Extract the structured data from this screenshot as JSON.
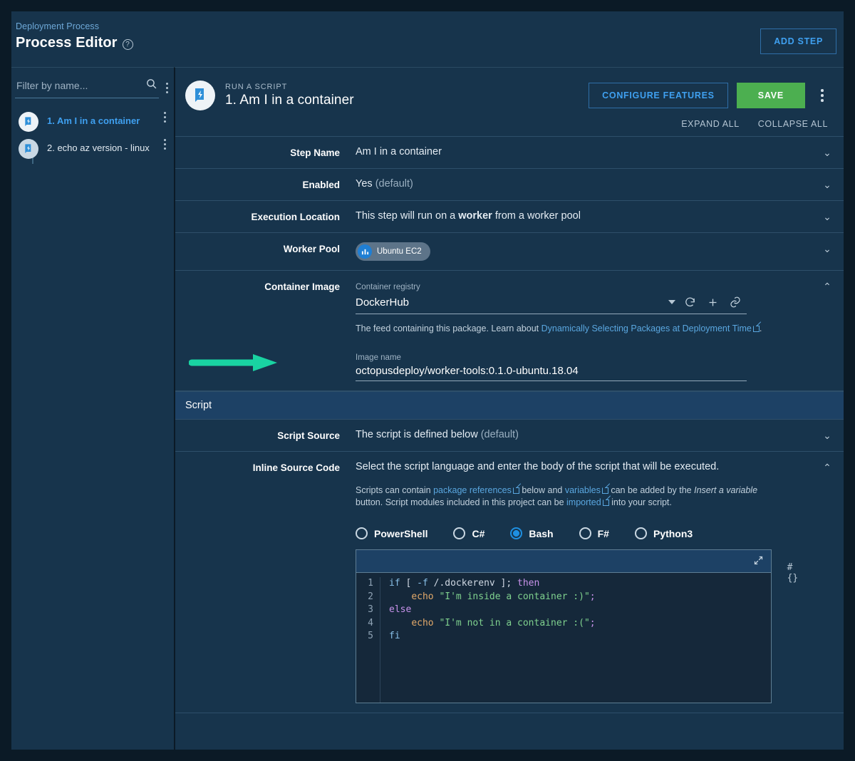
{
  "header": {
    "breadcrumb": "Deployment Process",
    "title": "Process Editor",
    "help_icon": "?",
    "add_step_label": "ADD STEP"
  },
  "sidebar": {
    "filter_placeholder": "Filter by name...",
    "filter_value": "",
    "search_icon": "search-icon",
    "steps": [
      {
        "label": "1. Am I in a container",
        "active": true
      },
      {
        "label": "2. echo az version - linux",
        "active": false
      }
    ]
  },
  "step": {
    "kicker": "RUN A SCRIPT",
    "title": "1. Am I in a container",
    "configure_features_label": "CONFIGURE FEATURES",
    "save_label": "SAVE",
    "expand_all": "EXPAND ALL",
    "collapse_all": "COLLAPSE ALL"
  },
  "rows": {
    "step_name": {
      "label": "Step Name",
      "value": "Am I in a container",
      "chevron": "⌄"
    },
    "enabled": {
      "label": "Enabled",
      "value": "Yes",
      "suffix": "(default)",
      "chevron": "⌄"
    },
    "execution_location": {
      "label": "Execution Location",
      "pre": "This step will run on a ",
      "strong": "worker",
      "post": " from a worker pool",
      "chevron": "⌄"
    },
    "worker_pool": {
      "label": "Worker Pool",
      "chip": "Ubuntu EC2",
      "chevron": "⌄"
    },
    "container_image": {
      "label": "Container Image",
      "chevron": "⌃"
    },
    "script_source": {
      "label": "Script Source",
      "value": "The script is defined below",
      "suffix": "(default)",
      "chevron": "⌄"
    },
    "inline_source_code": {
      "label": "Inline Source Code",
      "value": "Select the script language and enter the body of the script that will be executed.",
      "chevron": "⌃"
    }
  },
  "container_image": {
    "registry_label": "Container registry",
    "registry_value": "DockerHub",
    "refresh_icon": "refresh-icon",
    "add_icon": "plus-icon",
    "link_icon": "link-icon",
    "feed_help_pre": "The feed containing this package. Learn about ",
    "feed_help_link": "Dynamically Selecting Packages at Deployment Time",
    "feed_help_post": ".",
    "image_name_label": "Image name",
    "image_name_value": "octopusdeploy/worker-tools:0.1.0-ubuntu.18.04"
  },
  "script_section": {
    "title": "Script",
    "help_1": "Scripts can contain ",
    "help_link_1": "package references",
    "help_2": " below and ",
    "help_link_2": "variables",
    "help_3": " can be added by the ",
    "help_em": "Insert a variable",
    "help_4": " button. Script modules included in this project can be ",
    "help_link_3": "imported",
    "help_5": " into your script.",
    "languages": [
      {
        "label": "PowerShell",
        "selected": false
      },
      {
        "label": "C#",
        "selected": false
      },
      {
        "label": "Bash",
        "selected": true
      },
      {
        "label": "F#",
        "selected": false
      },
      {
        "label": "Python3",
        "selected": false
      }
    ],
    "insert_variable_button": "#{}",
    "expand_editor_icon": "expand-icon",
    "code_lines": [
      "1",
      "2",
      "3",
      "4",
      "5"
    ],
    "code": "if [ -f /.dockerenv ]; then\n    echo \"I'm inside a container :)\";\nelse\n    echo \"I'm not in a container :(\";\nfi"
  },
  "annotation": {
    "arrow_color": "#19d3a2"
  }
}
